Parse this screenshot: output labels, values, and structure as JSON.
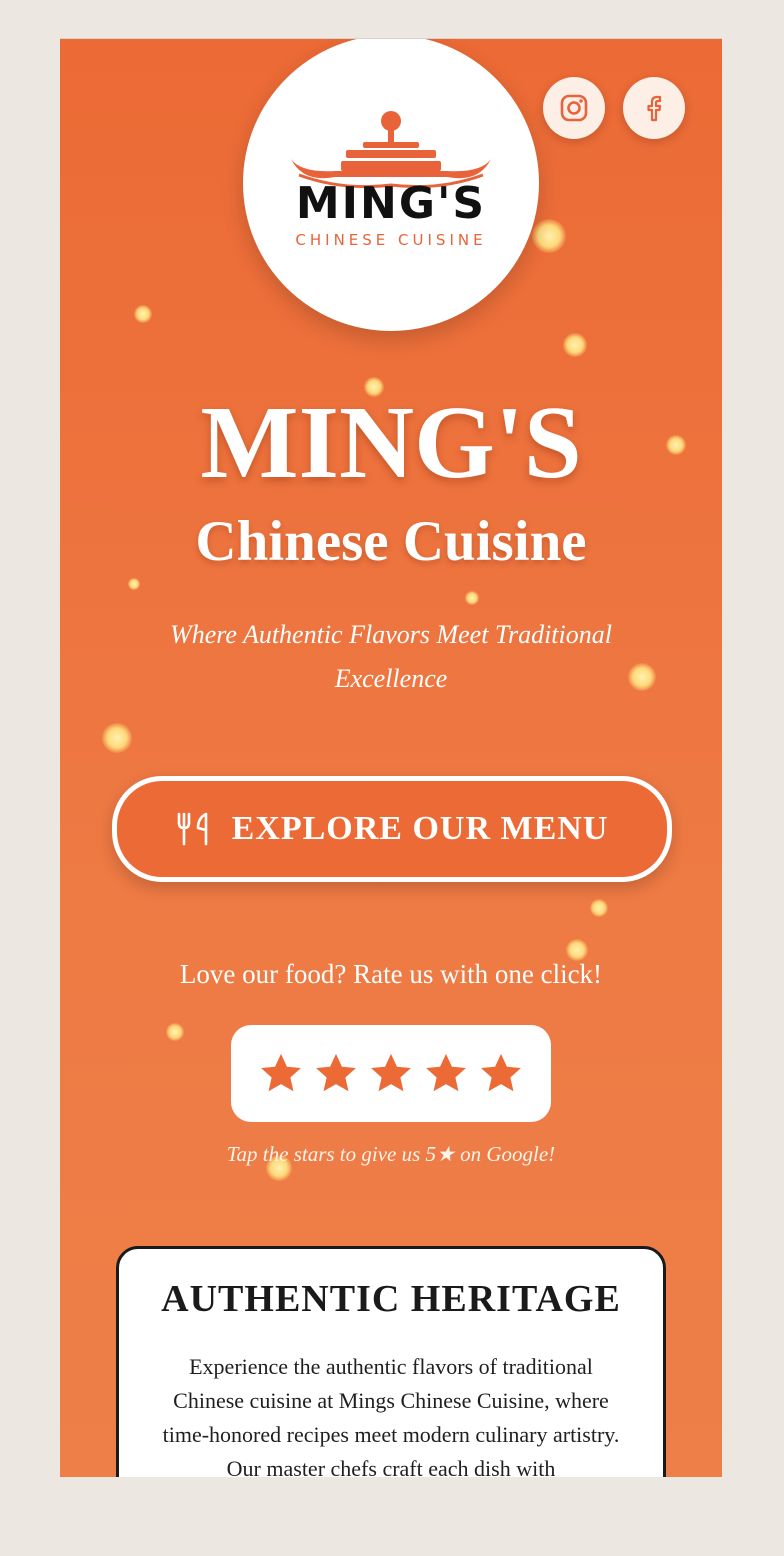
{
  "brand": {
    "logo_word": "MING'S",
    "logo_sub": "CHINESE CUISINE",
    "accent": "#ec6a35",
    "logo_accent": "#e8633a"
  },
  "social": {
    "instagram_icon": "instagram-icon",
    "facebook_icon": "facebook-icon"
  },
  "hero": {
    "title": "MING'S",
    "subtitle": "Chinese Cuisine",
    "tagline": "Where Authentic Flavors Meet Traditional Excellence"
  },
  "menu_button": {
    "icon": "utensils-icon",
    "label": "EXPLORE OUR MENU"
  },
  "rating": {
    "prompt": "Love our food? Rate us with one click!",
    "stars": 5,
    "star_color": "#ec6a35",
    "note": "Tap the stars to give us 5★ on Google!"
  },
  "heritage": {
    "title": "AUTHENTIC HERITAGE",
    "text": "Experience the authentic flavors of traditional Chinese cuisine at Mings Chinese Cuisine, where time-honored recipes meet modern culinary artistry. Our master chefs craft each dish with"
  }
}
